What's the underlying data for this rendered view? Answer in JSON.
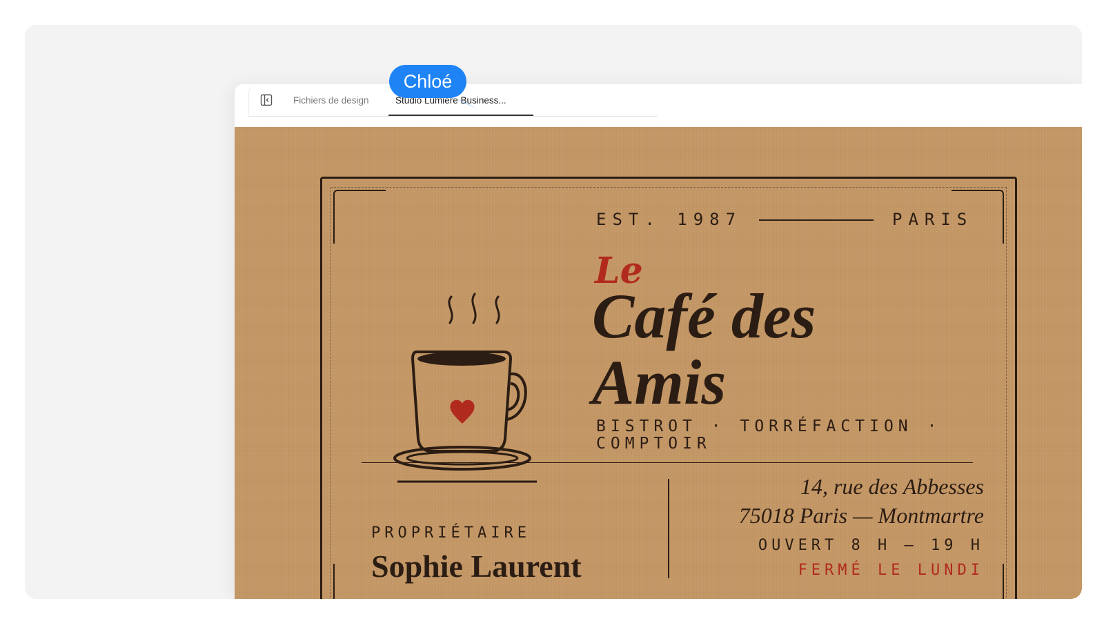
{
  "tabs": {
    "files": "Fichiers de design",
    "active": "Studio Lumière Business..."
  },
  "collaborator": {
    "name": "Chloé",
    "color": "#1e84f5"
  },
  "card": {
    "est": "EST. 1987",
    "city": "PARIS",
    "title_prefix": "Le",
    "title": "Café des Amis",
    "tagline": "BISTROT · TORRÉFACTION · COMPTOIR",
    "owner_label": "PROPRIÉTAIRE",
    "owner_name": "Sophie Laurent",
    "address_line1": "14, rue des Abbesses",
    "address_line2": "75018 Paris — Montmartre",
    "hours": "OUVERT 8 H – 19 H",
    "closed": "FERMÉ LE LUNDI"
  },
  "colors": {
    "kraft": "#c49766",
    "ink": "#2b1d13",
    "accent_red": "#b12a1e"
  },
  "icons": {
    "sidebar_toggle": "sidebar-toggle-icon",
    "cup": "coffee-cup-icon",
    "heart": "heart-icon",
    "steam": "steam-icon",
    "cursor": "cursor-arrow-icon"
  }
}
